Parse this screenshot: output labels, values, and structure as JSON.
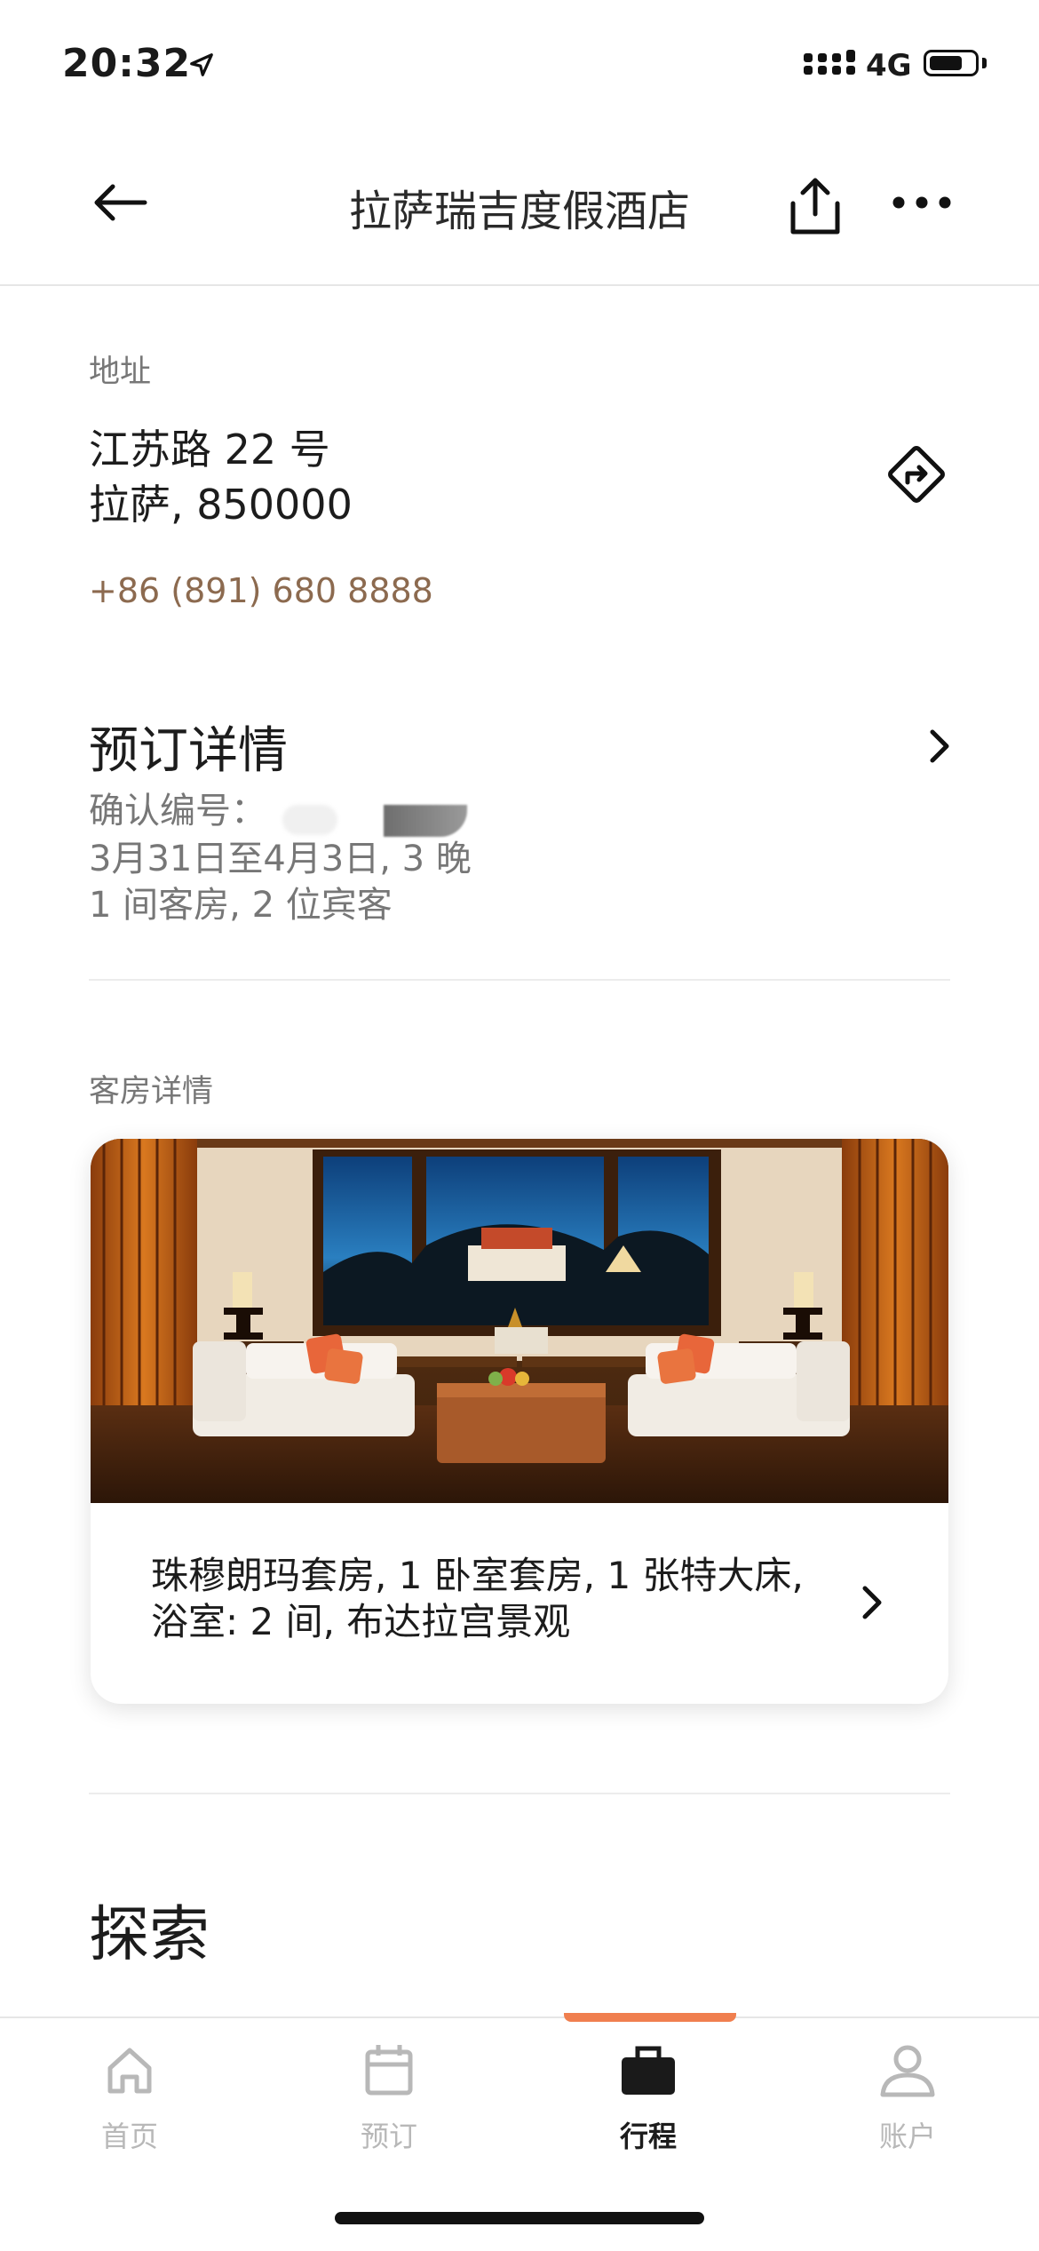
{
  "status_bar": {
    "time": "20:32",
    "network": "4G"
  },
  "header": {
    "title": "拉萨瑞吉度假酒店"
  },
  "address": {
    "label": "地址",
    "line1": "江苏路 22 号",
    "line2": "拉萨, 850000",
    "phone": "+86 (891) 680 8888"
  },
  "booking": {
    "title": "预订详情",
    "confirmation_label": "确认编号：",
    "dates": "3月31日至4月3日, 3 晚",
    "guests": "1 间客房, 2 位宾客"
  },
  "room": {
    "label": "客房详情",
    "description": "珠穆朗玛套房, 1 卧室套房, 1  张特大床, 浴室: 2 间, 布达拉宫景观"
  },
  "explore": {
    "title": "探索"
  },
  "tabs": [
    {
      "label": "首页",
      "icon": "home-icon",
      "active": false
    },
    {
      "label": "预订",
      "icon": "calendar-icon",
      "active": false
    },
    {
      "label": "行程",
      "icon": "briefcase-icon",
      "active": true
    },
    {
      "label": "账户",
      "icon": "user-icon",
      "active": false
    }
  ],
  "colors": {
    "accent": "#f07f4f",
    "phone": "#8c6a4f"
  }
}
